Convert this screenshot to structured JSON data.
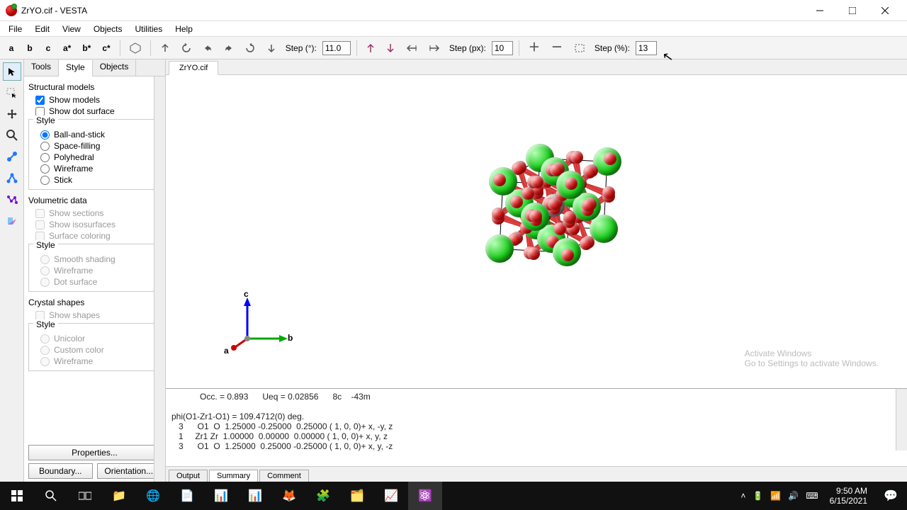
{
  "window": {
    "title": "ZrYO.cif - VESTA"
  },
  "menu": [
    "File",
    "Edit",
    "View",
    "Objects",
    "Utilities",
    "Help"
  ],
  "toolbar": {
    "axes": [
      "a",
      "b",
      "c",
      "a*",
      "b*",
      "c*"
    ],
    "step_deg_label": "Step (°):",
    "step_deg": "11.0",
    "step_px_label": "Step (px):",
    "step_px": "10",
    "step_pct_label": "Step (%):",
    "step_pct": "13"
  },
  "side": {
    "tabs": [
      "Tools",
      "Style",
      "Objects"
    ],
    "active_tab": 1,
    "structural_label": "Structural models",
    "show_models": "Show models",
    "show_dot_surface": "Show dot surface",
    "style_label": "Style",
    "styles": [
      "Ball-and-stick",
      "Space-filling",
      "Polyhedral",
      "Wireframe",
      "Stick"
    ],
    "volumetric_label": "Volumetric data",
    "vol_opts": [
      "Show sections",
      "Show isosurfaces",
      "Surface coloring"
    ],
    "vol_styles": [
      "Smooth shading",
      "Wireframe",
      "Dot surface"
    ],
    "crystal_label": "Crystal shapes",
    "show_shapes": "Show shapes",
    "shape_styles": [
      "Unicolor",
      "Custom color",
      "Wireframe"
    ],
    "properties_btn": "Properties...",
    "boundary_btn": "Boundary...",
    "orientation_btn": "Orientation..."
  },
  "file_tab": "ZrYO.cif",
  "axes_compass": {
    "a": "a",
    "b": "b",
    "c": "c"
  },
  "console": {
    "lines": [
      "            Occ. = 0.893      Ueq = 0.02856      8c    -43m",
      "",
      "phi(O1-Zr1-O1) = 109.4712(0) deg.",
      "   3      O1  O  1.25000 -0.25000  0.25000 ( 1, 0, 0)+ x, -y, z",
      "   1     Zr1 Zr  1.00000  0.00000  0.00000 ( 1, 0, 0)+ x, y, z",
      "   3      O1  O  1.25000  0.25000 -0.25000 ( 1, 0, 0)+ x, y, -z"
    ],
    "tabs": [
      "Output",
      "Summary",
      "Comment"
    ]
  },
  "watermark": {
    "title": "Activate Windows",
    "sub": "Go to Settings to activate Windows."
  },
  "taskbar": {
    "time": "9:50 AM",
    "date": "6/15/2021"
  }
}
